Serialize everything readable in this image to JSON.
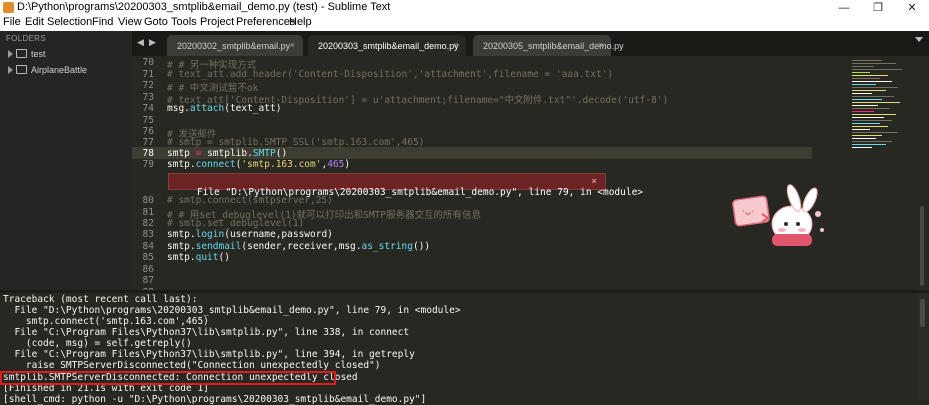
{
  "window": {
    "title": "D:\\Python\\programs\\20200303_smtplib&email_demo.py (test) - Sublime Text",
    "minimize": "—",
    "maximize": "❐",
    "close": "✕"
  },
  "menu": [
    "File",
    "Edit",
    "Selection",
    "Find",
    "View",
    "Goto",
    "Tools",
    "Project",
    "Preferences",
    "Help"
  ],
  "sidebar": {
    "header": "FOLDERS",
    "items": [
      {
        "label": "test",
        "icon": "folder-icon"
      },
      {
        "label": "AirplaneBattle",
        "icon": "folder-icon"
      }
    ]
  },
  "tabs": [
    {
      "label": "20200302_smtplib&email.py",
      "active": false,
      "close": "×"
    },
    {
      "label": "20200303_smtplib&email_demo.py",
      "active": true,
      "close": "×"
    },
    {
      "label": "20200305_smtplib&email_demo.py",
      "active": false,
      "close": "×"
    }
  ],
  "tab_nav": {
    "prev": "◀",
    "next": "▶"
  },
  "editor": {
    "gutter": [
      "70",
      "71",
      "72",
      "73",
      "74",
      "75",
      "76",
      "77",
      "78",
      "79",
      "",
      "80",
      "81",
      "82",
      "83",
      "84",
      "85",
      "86",
      "87",
      "88"
    ],
    "current_line": "78",
    "lines": {
      "l70": "# # 另一种实现方式",
      "l71": "# text_att.add_header('Content-Disposition','attachment',filename = 'aaa.txt')",
      "l72": "# # 中文测试暂不ok",
      "l73": "# text_att['Content-Disposition'] = u'attachment;filename=\"中文附件.txt\"'.decode('utf-8')",
      "l74_a": "msg.",
      "l74_b": "attach",
      "l74_c": "(text_att)",
      "l76": "# 发送邮件",
      "l77": "# smtp = smtplib.SMTP_SSL('smtp.163.com',465)",
      "l78_a": "smtp ",
      "l78_b": "=",
      "l78_c": " smtplib.",
      "l78_d": "SMTP",
      "l78_e": "()",
      "l79_a": "smtp.",
      "l79_b": "connect",
      "l79_c": "(",
      "l79_d": "'smtp.163.com'",
      "l79_e": ",",
      "l79_f": "465",
      "l79_g": ")",
      "l80": "# smtp.connect(smtpserver,25)",
      "l81": "# # 用set_debuglevel(1)就可以打印出和SMTP服务器交互的所有信息",
      "l82": "# smtp.set_debuglevel(1)",
      "l83_a": "smtp.",
      "l83_b": "login",
      "l83_c": "(username,password)",
      "l84_a": "smtp.",
      "l84_b": "sendmail",
      "l84_c": "(sender,receiver,msg.",
      "l84_d": "as_string",
      "l84_e": "())",
      "l85_a": "smtp.",
      "l85_b": "quit",
      "l85_c": "()"
    },
    "error_annotation": "File \"D:\\Python\\programs\\20200303_smtplib&email_demo.py\", line 79, in <module>",
    "error_close": "×"
  },
  "console": {
    "lines": [
      "Traceback (most recent call last):",
      "  File \"D:\\Python\\programs\\20200303_smtplib&email_demo.py\", line 79, in <module>",
      "    smtp.connect('smtp.163.com',465)",
      "  File \"C:\\Program Files\\Python37\\lib\\smtplib.py\", line 338, in connect",
      "    (code, msg) = self.getreply()",
      "  File \"C:\\Program Files\\Python37\\lib\\smtplib.py\", line 394, in getreply",
      "    raise SMTPServerDisconnected(\"Connection unexpectedly closed\")",
      "smtplib.SMTPServerDisconnected: Connection unexpectedly closed",
      "[Finished in 21.1s with exit code 1]",
      "[shell_cmd: python -u \"D:\\Python\\programs\\20200303_smtplib&email_demo.py\"]"
    ]
  },
  "colors": {
    "background": "#272822",
    "comment": "#75715e",
    "string": "#e6db74",
    "function": "#66d9ef",
    "number": "#ae81ff",
    "operator": "#f92672",
    "error_bar": "#6b2323",
    "highlight_box": "#e01c1c"
  }
}
